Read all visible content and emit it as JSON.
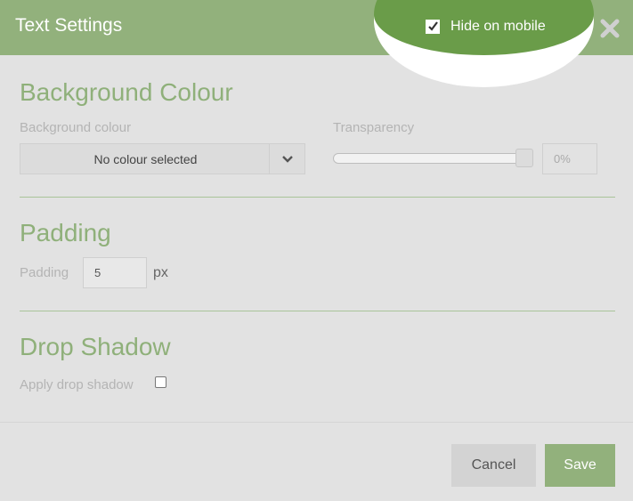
{
  "header": {
    "title": "Text Settings",
    "hide_on_mobile_label": "Hide on mobile",
    "hide_on_mobile_checked": true,
    "close_icon": "close-icon"
  },
  "background": {
    "section_title": "Background Colour",
    "colour_label": "Background colour",
    "colour_value": "No colour selected",
    "transparency_label": "Transparency",
    "transparency_value": "0%"
  },
  "padding": {
    "section_title": "Padding",
    "label": "Padding",
    "value": "5",
    "unit": "px"
  },
  "drop_shadow": {
    "section_title": "Drop Shadow",
    "label": "Apply drop shadow",
    "checked": false
  },
  "footer": {
    "cancel_label": "Cancel",
    "save_label": "Save"
  },
  "colors": {
    "accent": "#92b17c",
    "accent_dark": "#6a9c49",
    "background": "#e2e2e2"
  }
}
